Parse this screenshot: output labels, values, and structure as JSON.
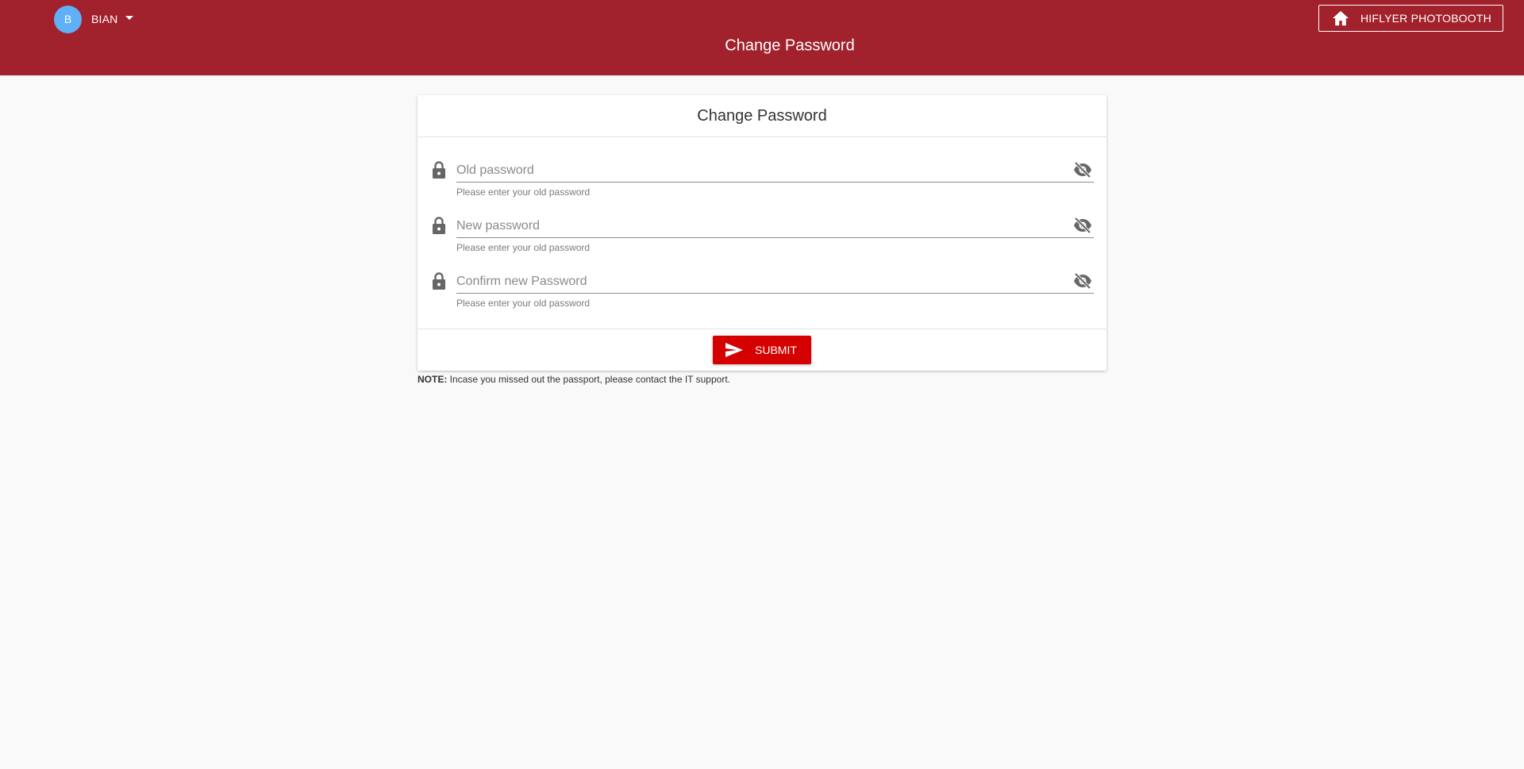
{
  "header": {
    "title": "Change Password",
    "user": {
      "avatar_initial": "B",
      "name": "BIAN"
    },
    "home_button_label": "HIFLYER PHOTOBOOTH"
  },
  "card": {
    "title": "Change Password",
    "fields": [
      {
        "placeholder": "Old password",
        "hint": "Please enter your old password"
      },
      {
        "placeholder": "New password",
        "hint": "Please enter your old password"
      },
      {
        "placeholder": "Confirm new Password",
        "hint": "Please enter your old password"
      }
    ],
    "submit_label": "SUBMIT"
  },
  "note": {
    "label": "NOTE:",
    "text": " Incase you missed out the passport, please contact the IT support."
  },
  "colors": {
    "header_bg": "#a1212c",
    "submit_bg": "#d50000",
    "avatar_bg": "#5fb0f5"
  }
}
